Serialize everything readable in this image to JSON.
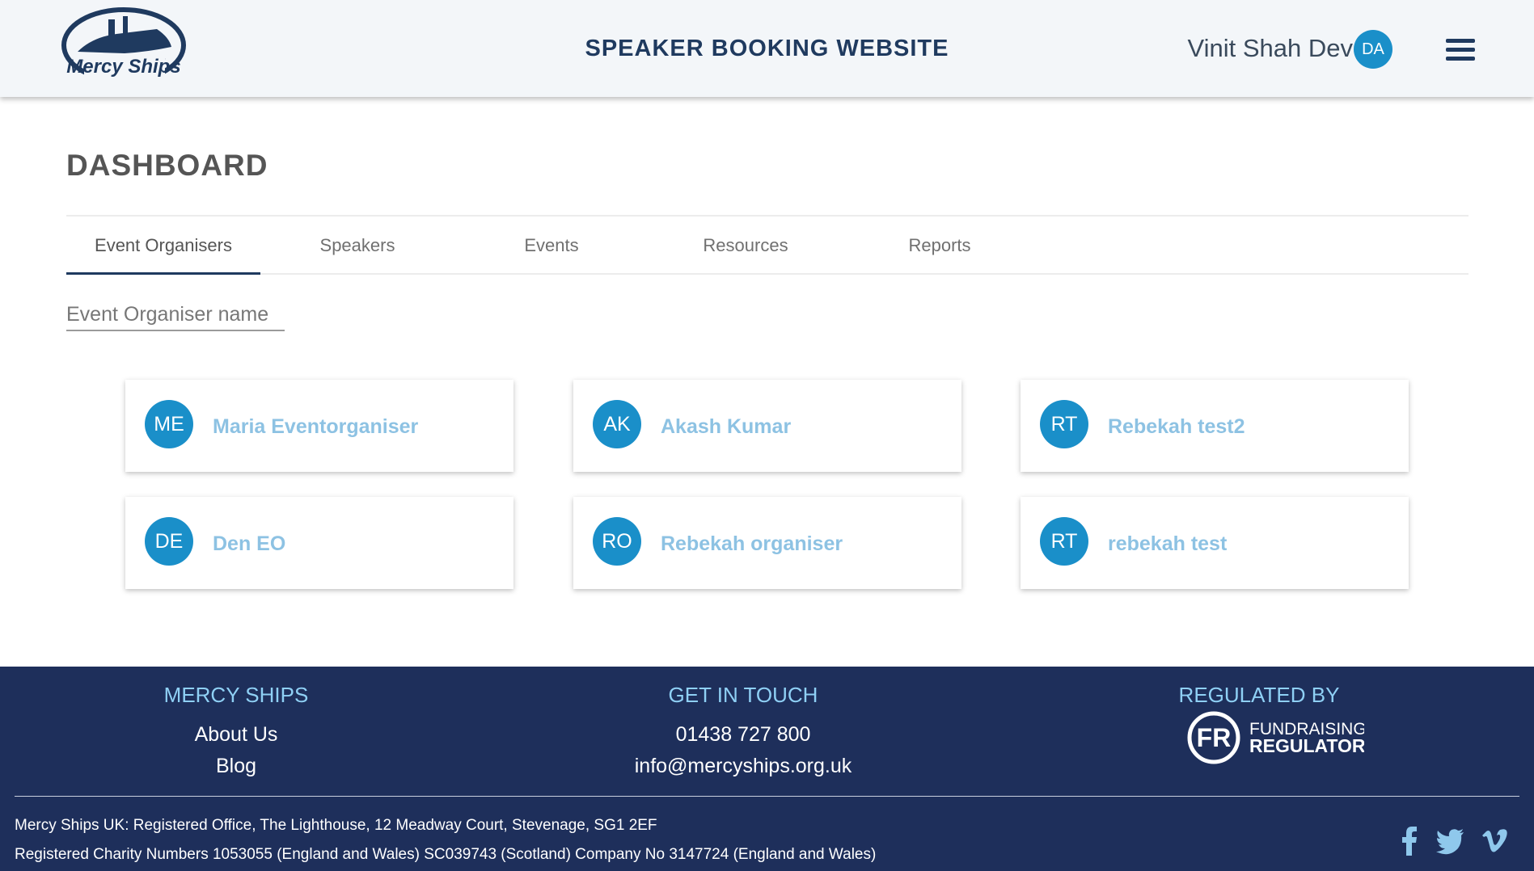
{
  "header": {
    "brand": "Mercy Ships",
    "title": "SPEAKER BOOKING WEBSITE",
    "user_name": "Vinit Shah Dev",
    "user_initials": "DA"
  },
  "page": {
    "title": "DASHBOARD"
  },
  "tabs": [
    {
      "label": "Event Organisers",
      "active": true
    },
    {
      "label": "Speakers",
      "active": false
    },
    {
      "label": "Events",
      "active": false
    },
    {
      "label": "Resources",
      "active": false
    },
    {
      "label": "Reports",
      "active": false
    }
  ],
  "search": {
    "placeholder": "Event Organiser name",
    "value": ""
  },
  "organisers": [
    {
      "initials": "ME",
      "name": "Maria Eventorganiser"
    },
    {
      "initials": "AK",
      "name": "Akash Kumar"
    },
    {
      "initials": "RT",
      "name": "Rebekah test2"
    },
    {
      "initials": "DE",
      "name": "Den EO"
    },
    {
      "initials": "RO",
      "name": "Rebekah organiser"
    },
    {
      "initials": "RT",
      "name": "rebekah test"
    }
  ],
  "footer": {
    "col1": {
      "heading": "MERCY SHIPS",
      "links": [
        "About Us",
        "Blog"
      ]
    },
    "col2": {
      "heading": "GET IN TOUCH",
      "phone": "01438 727 800",
      "email": "info@mercyships.org.uk"
    },
    "col3": {
      "heading": "REGULATED BY",
      "badge": "FR",
      "regulator_line1": "FUNDRAISING",
      "regulator_line2": "REGULATOR"
    },
    "legal_line1": "Mercy Ships UK: Registered Office, The Lighthouse, 12 Meadway Court, Stevenage, SG1 2EF",
    "legal_line2": "Registered Charity Numbers 1053055 (England and Wales) SC039743 (Scotland) Company No 3147724 (England and Wales)",
    "social": [
      "facebook-icon",
      "twitter-icon",
      "vimeo-icon"
    ]
  },
  "colors": {
    "header_bg": "#f3f6f9",
    "navy": "#1f3a5f",
    "avatar": "#1a8fc9",
    "card_name": "#8dc2e3",
    "footer_bg": "#1e2f5b",
    "footer_heading": "#8fd0f5"
  }
}
